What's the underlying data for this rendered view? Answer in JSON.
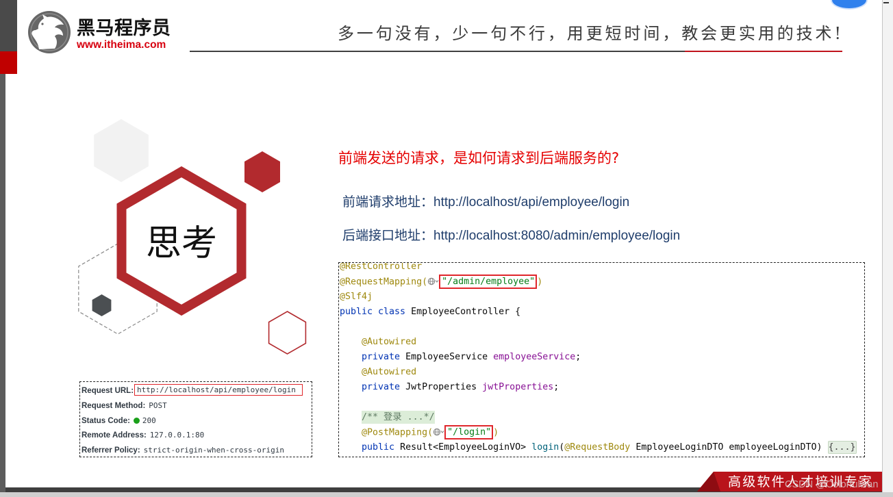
{
  "viewer": {
    "assistant_button_color": "#2f80ed"
  },
  "slide": {
    "header": {
      "logo_icon": "horse-head-logo-icon",
      "brand_name": "黑马程序员",
      "brand_url": "www.itheima.com",
      "slogan": "多一句没有，少一句不行，用更短时间，教会更实用的技术!"
    },
    "colors": {
      "brand_red": "#b22a2e",
      "question_red": "#e50000",
      "address_navy": "#1f3d6b",
      "url_red": "#d7000f",
      "banner_red": "#b9141b",
      "status_ok_green": "#1aa01a"
    },
    "think_label": "思考",
    "question": "前端发送的请求，是如何请求到后端服务的?",
    "addresses": [
      {
        "label": "前端请求地址：",
        "url": "http://localhost/api/employee/login"
      },
      {
        "label": "后端接口地址：",
        "url": "http://localhost:8080/admin/employee/login"
      }
    ],
    "code": {
      "lines": [
        {
          "tokens": [
            {
              "text": "@RestController",
              "color": "#9e880d"
            }
          ]
        },
        {
          "tokens": [
            {
              "text": "@RequestMapping(",
              "color": "#9e880d"
            },
            {
              "icon": "globe-chevron-icon"
            },
            {
              "text": "\"/admin/employee\"",
              "color": "#067d17",
              "boxed": true
            },
            {
              "text": ")",
              "color": "#9e880d"
            }
          ]
        },
        {
          "tokens": [
            {
              "text": "@Slf4j",
              "color": "#9e880d"
            }
          ]
        },
        {
          "tokens": [
            {
              "text": "public class ",
              "color": "#0033b3"
            },
            {
              "text": "EmployeeController {",
              "color": "#080808"
            }
          ]
        },
        {
          "tokens": []
        },
        {
          "tokens": [
            {
              "text": "    @Autowired",
              "color": "#9e880d"
            }
          ]
        },
        {
          "tokens": [
            {
              "text": "    private ",
              "color": "#0033b3"
            },
            {
              "text": "EmployeeService ",
              "color": "#080808"
            },
            {
              "text": "employeeService",
              "color": "#871094"
            },
            {
              "text": ";",
              "color": "#080808"
            }
          ]
        },
        {
          "tokens": [
            {
              "text": "    @Autowired",
              "color": "#9e880d"
            }
          ]
        },
        {
          "tokens": [
            {
              "text": "    private ",
              "color": "#0033b3"
            },
            {
              "text": "JwtProperties ",
              "color": "#080808"
            },
            {
              "text": "jwtProperties",
              "color": "#871094"
            },
            {
              "text": ";",
              "color": "#080808"
            }
          ]
        },
        {
          "tokens": []
        },
        {
          "tokens": [
            {
              "text": "    ",
              "color": "#080808"
            },
            {
              "text": "/** 登录 ...*/",
              "color": "#5f7a63",
              "background": "#dcedd8"
            }
          ]
        },
        {
          "tokens": [
            {
              "text": "    @PostMapping(",
              "color": "#9e880d"
            },
            {
              "icon": "globe-chevron-icon"
            },
            {
              "text": "\"/login\"",
              "color": "#067d17",
              "boxed": true
            },
            {
              "text": ")",
              "color": "#9e880d"
            }
          ]
        },
        {
          "tokens": [
            {
              "text": "    public ",
              "color": "#0033b3"
            },
            {
              "text": "Result<EmployeeLoginVO> ",
              "color": "#080808"
            },
            {
              "text": "login",
              "color": "#00627a"
            },
            {
              "text": "(",
              "color": "#080808"
            },
            {
              "text": "@RequestBody",
              "color": "#9e880d"
            },
            {
              "text": " EmployeeLoginDTO employeeLoginDTO) ",
              "color": "#080808"
            },
            {
              "text": "{...}",
              "color": "#444444",
              "background": "#e4eee2",
              "fold": true
            }
          ]
        }
      ]
    },
    "request_info": [
      {
        "label": "Request URL:",
        "value": "http://localhost/api/employee/login"
      },
      {
        "label": "Request Method:",
        "value": "POST"
      },
      {
        "label": "Status Code:",
        "value": "200"
      },
      {
        "label": "Remote Address:",
        "value": "127.0.0.1:80"
      },
      {
        "label": "Referrer Policy:",
        "value": "strict-origin-when-cross-origin"
      }
    ],
    "footer": {
      "banner": "高级软件人才培训专家",
      "watermark": "CSDN @Colorfulwan"
    }
  }
}
